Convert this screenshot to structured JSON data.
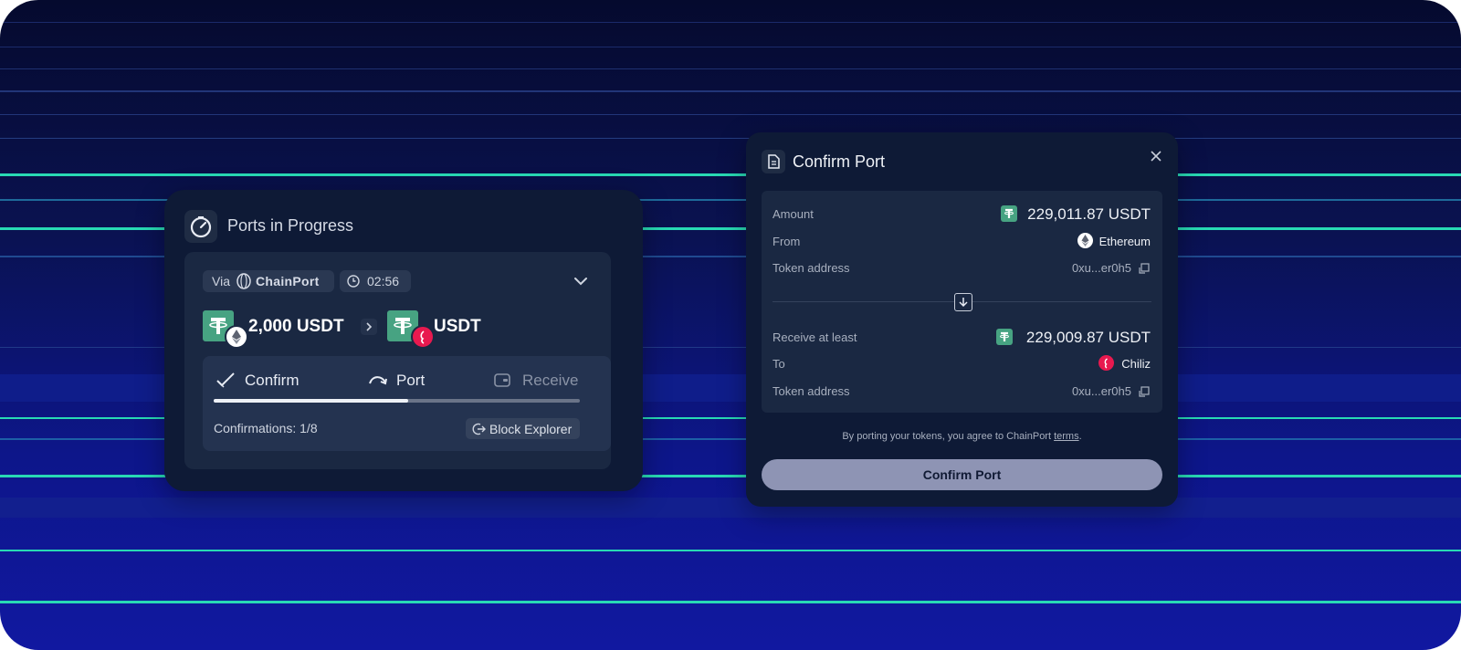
{
  "progress": {
    "title": "Ports in Progress",
    "via_label": "Via",
    "brand": "ChainPort",
    "timer": "02:56",
    "from_amount": "2,000 USDT",
    "to_token": "USDT",
    "steps": [
      {
        "label": "Confirm",
        "state": "done"
      },
      {
        "label": "Port",
        "state": "active"
      },
      {
        "label": "Receive",
        "state": "pending"
      }
    ],
    "progress_fraction": 0.53,
    "confirmations": "Confirmations: 1/8",
    "explorer_label": "Block Explorer"
  },
  "confirm": {
    "title": "Confirm Port",
    "amount_label": "Amount",
    "amount_value": "229,011.87 USDT",
    "from_label": "From",
    "from_chain": "Ethereum",
    "token_address_label": "Token address",
    "token_address_from": "0xu...er0h5",
    "receive_label": "Receive at least",
    "receive_value": "229,009.87 USDT",
    "to_label": "To",
    "to_chain": "Chiliz",
    "token_address_to": "0xu...er0h5",
    "terms_prefix": "By porting your tokens, you agree to ChainPort ",
    "terms_link": "terms",
    "terms_suffix": ".",
    "button_label": "Confirm Port"
  },
  "colors": {
    "accent_line": "#28d9b4",
    "card_bg": "#0e1a36",
    "panel_bg": "#1a2842",
    "tether_green": "#47a382",
    "chiliz_red": "#e8194f",
    "button_bg": "#8e94b4"
  },
  "icons": [
    "timer-icon",
    "chainport-logo",
    "clock-icon",
    "chevron-down-icon",
    "tether-icon",
    "ethereum-icon",
    "chiliz-icon",
    "check-icon",
    "port-arrow-icon",
    "wallet-icon",
    "external-link-icon",
    "document-icon",
    "close-icon",
    "copy-icon",
    "arrow-down-icon"
  ]
}
